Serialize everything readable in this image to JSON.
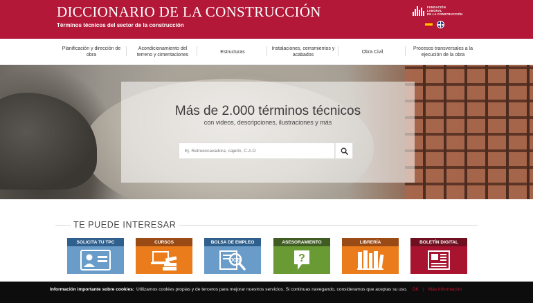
{
  "header": {
    "title": "DICCIONARIO DE LA CONSTRUCCIÓN",
    "subtitle": "Términos técnicos del sector de la construcción",
    "org_logo_lines": [
      "FUNDACIÓN",
      "LABORAL",
      "DE LA CONSTRUCCIÓN"
    ],
    "languages": [
      "es",
      "en"
    ]
  },
  "nav": {
    "items": [
      {
        "label": "Planificación y dirección de obra"
      },
      {
        "label": "Acondicionamiento del terreno y cimentaciones"
      },
      {
        "label": "Estructuras"
      },
      {
        "label": "Instalaciones, cerramientos y acabados"
      },
      {
        "label": "Obra Civil"
      },
      {
        "label": "Procesos transversales a la ejecución de la obra"
      }
    ]
  },
  "hero": {
    "title": "Más de 2.000 términos técnicos",
    "subtitle": "con videos, descripciones, ilustraciones y más",
    "search_placeholder": "Ej. Retroexcavadora, cajetín, C.A.D"
  },
  "interest": {
    "title": "TE PUEDE INTERESAR",
    "tiles": [
      {
        "label": "SOLICITA TU TPC",
        "icon": "id-card-icon",
        "header_color": "#2f5f8c",
        "body_color": "#6a9cc9"
      },
      {
        "label": "CURSOS",
        "icon": "books-laptop-icon",
        "header_color": "#9a4a15",
        "body_color": "#ea7c1c"
      },
      {
        "label": "BOLSA DE EMPLEO",
        "icon": "job-search-icon",
        "header_color": "#2f5f8c",
        "body_color": "#6a9cc9"
      },
      {
        "label": "ASESORAMIENTO",
        "icon": "question-icon",
        "header_color": "#3f5c22",
        "body_color": "#6a9a34"
      },
      {
        "label": "LIBRERÍA",
        "icon": "bookshelf-icon",
        "header_color": "#9a4a15",
        "body_color": "#ea7c1c"
      },
      {
        "label": "BOLETÍN DIGITAL",
        "icon": "newsletter-icon",
        "header_color": "#6e1020",
        "body_color": "#a8142f"
      }
    ]
  },
  "cookies": {
    "heading": "Información importante sobre cookies:",
    "text": "Utilizamos cookies propias y de terceros para mejorar nuestros servicios. Si continuas navegando, consideramos que aceptas su uso.",
    "ok_label": "OK",
    "separator": "|",
    "more_label": "Más información"
  }
}
